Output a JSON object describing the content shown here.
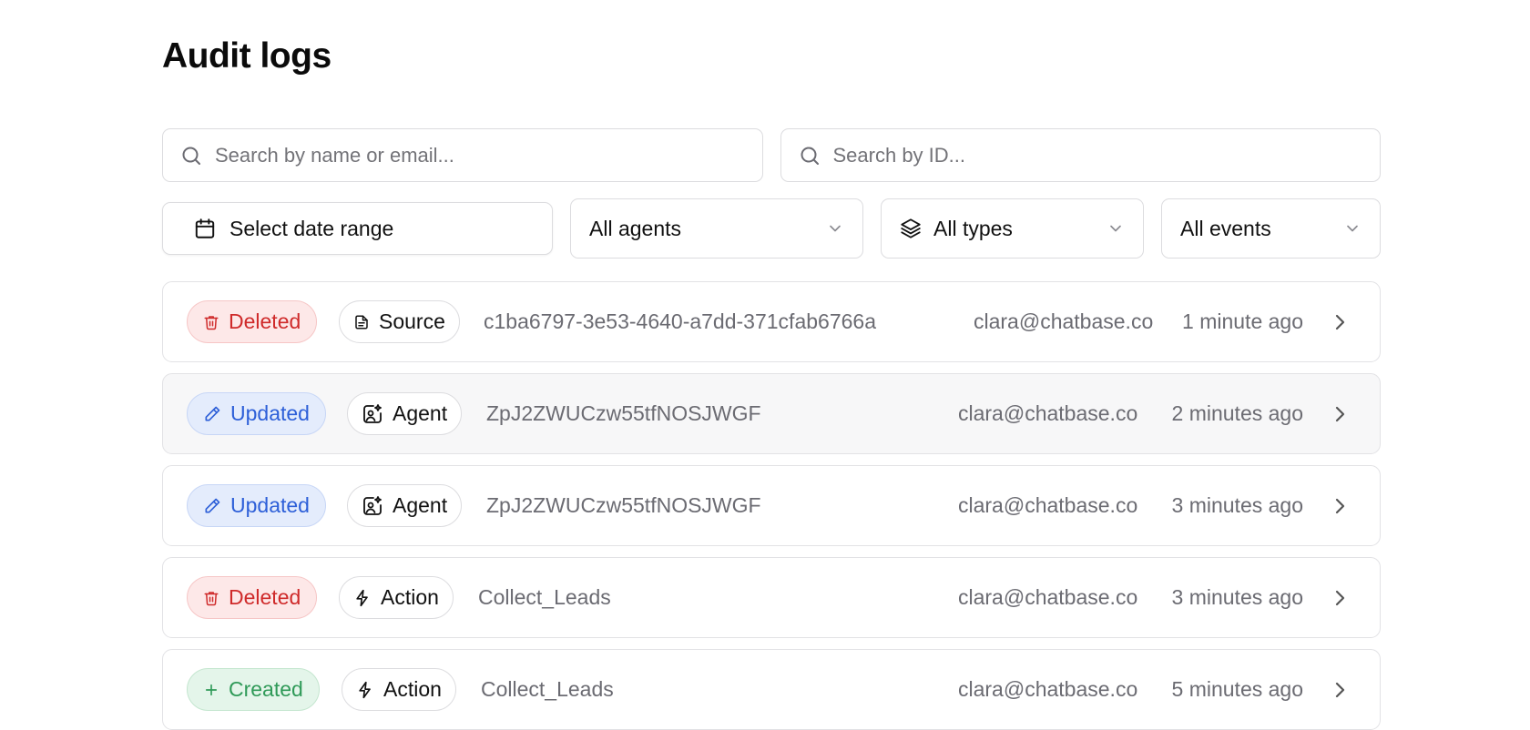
{
  "page": {
    "title": "Audit logs"
  },
  "search": {
    "name_placeholder": "Search by name or email...",
    "id_placeholder": "Search by ID..."
  },
  "filters": {
    "date_range": "Select date range",
    "agents": "All agents",
    "types": "All types",
    "events": "All events"
  },
  "icons": {
    "search": "search-icon",
    "calendar": "calendar-icon",
    "layers": "layers-icon",
    "chevron_down": "chevron-down-icon",
    "chevron_right": "chevron-right-icon",
    "trash": "trash-icon",
    "pencil": "pencil-icon",
    "plus": "plus-icon",
    "file": "file-icon",
    "agent": "agent-sparkle-icon",
    "action": "bolt-icon"
  },
  "colors": {
    "deleted": "#cf2a2a",
    "updated": "#2d5fd8",
    "created": "#2f9a58",
    "muted_text": "#6b6b72"
  },
  "logs": [
    {
      "event": "Deleted",
      "type": "Source",
      "id": "c1ba6797-3e53-4640-a7dd-371cfab6766a",
      "email": "clara@chatbase.co",
      "time": "1 minute ago"
    },
    {
      "event": "Updated",
      "type": "Agent",
      "id": "ZpJ2ZWUCzw55tfNOSJWGF",
      "email": "clara@chatbase.co",
      "time": "2 minutes ago"
    },
    {
      "event": "Updated",
      "type": "Agent",
      "id": "ZpJ2ZWUCzw55tfNOSJWGF",
      "email": "clara@chatbase.co",
      "time": "3 minutes ago"
    },
    {
      "event": "Deleted",
      "type": "Action",
      "id": "Collect_Leads",
      "email": "clara@chatbase.co",
      "time": "3 minutes ago"
    },
    {
      "event": "Created",
      "type": "Action",
      "id": "Collect_Leads",
      "email": "clara@chatbase.co",
      "time": "5 minutes ago"
    }
  ]
}
